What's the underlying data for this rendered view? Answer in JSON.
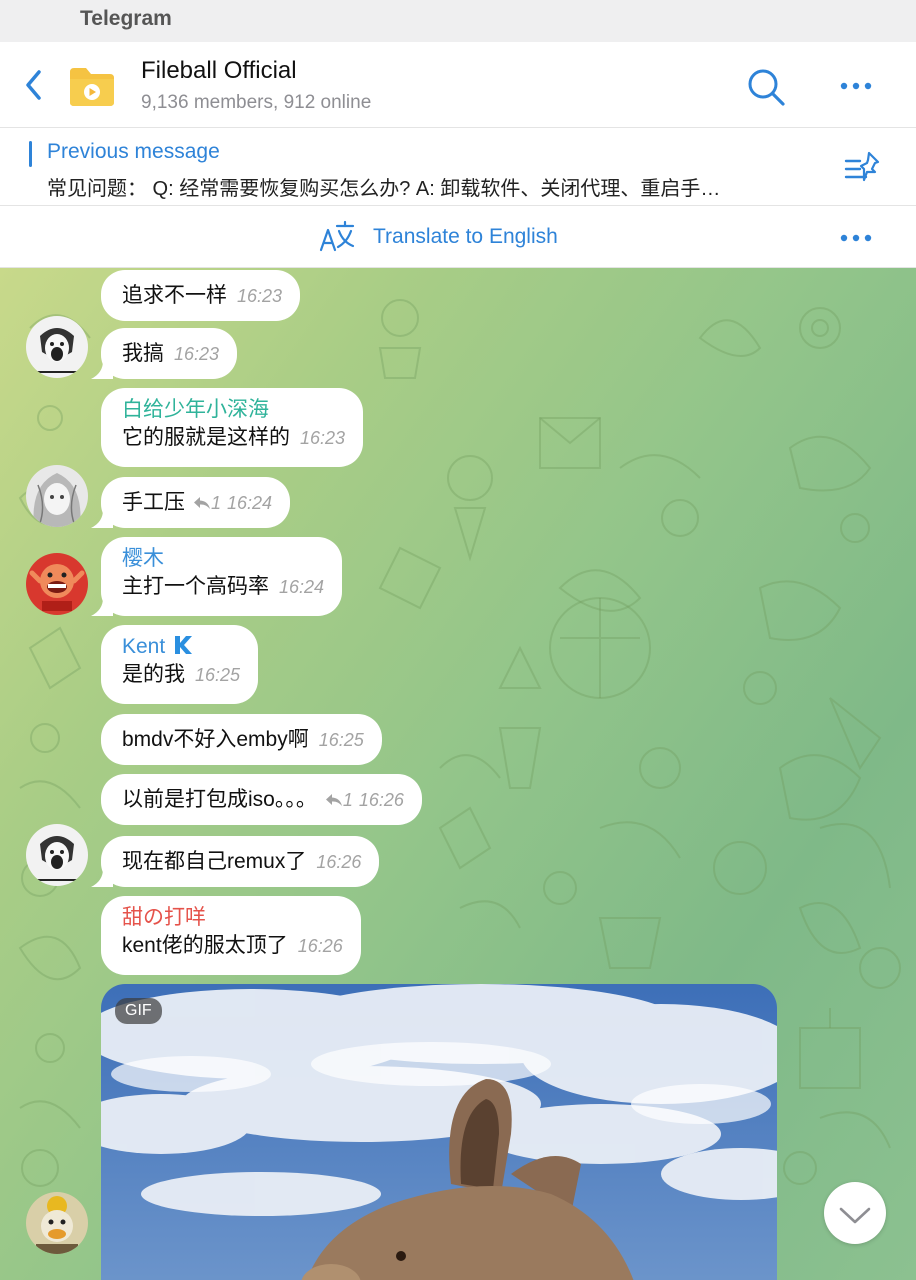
{
  "app": {
    "title": "Telegram"
  },
  "header": {
    "title": "Fileball Official",
    "subtitle": "9,136 members, 912 online"
  },
  "pinned": {
    "label": "Previous message",
    "text": "常见问题： Q: 经常需要恢复购买怎么办? A: 卸载软件、关闭代理、重启手…"
  },
  "translate": {
    "label": "Translate to English"
  },
  "colors": {
    "accent": "#2e83d8",
    "sender_teal": "#2fb39a",
    "sender_blue": "#3a8fd9",
    "sender_red": "#e5534b"
  },
  "messages": [
    {
      "text": "追求不一样",
      "time": "16:23"
    },
    {
      "text": "我搞",
      "time": "16:23"
    },
    {
      "sender": "白给少年小深海",
      "text": "它的服就是这样的",
      "time": "16:23"
    },
    {
      "text": "手工压",
      "reply_count": "1",
      "time": "16:24"
    },
    {
      "sender": "樱木",
      "text": "主打一个高码率",
      "time": "16:24"
    },
    {
      "sender": "Kent",
      "text": "是的我",
      "time": "16:25"
    },
    {
      "text": "bmdv不好入emby啊",
      "time": "16:25"
    },
    {
      "text": "以前是打包成iso。。。",
      "reply_count": "1",
      "time": "16:26"
    },
    {
      "text": "现在都自己remux了",
      "time": "16:26"
    },
    {
      "sender": "甜の打咩",
      "text": "kent佬的服太顶了",
      "time": "16:26"
    }
  ],
  "gif": {
    "badge": "GIF"
  }
}
